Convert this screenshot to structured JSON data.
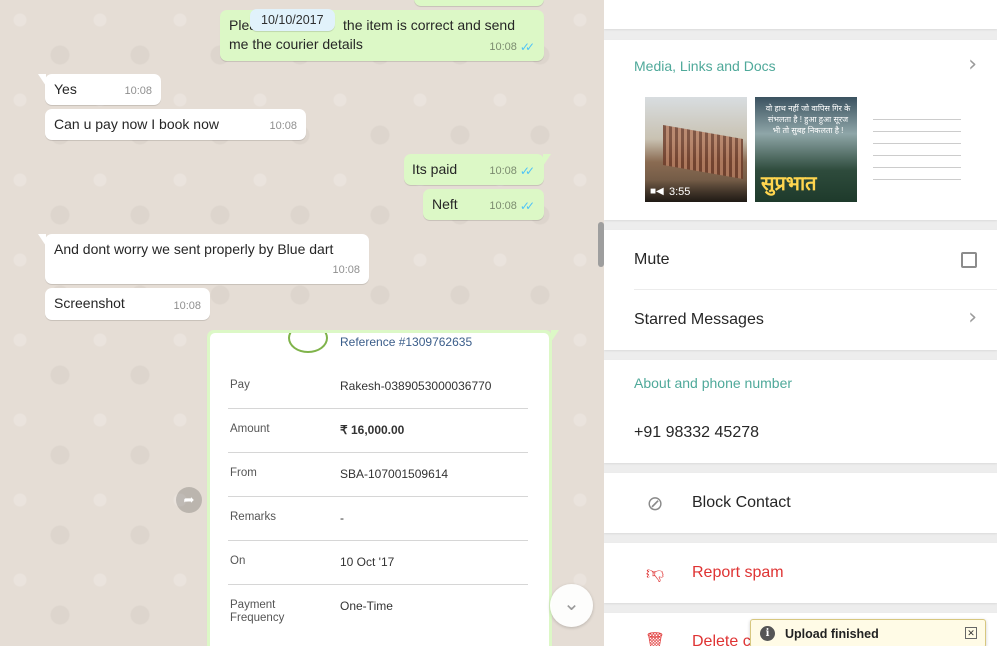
{
  "chat": {
    "date_chip": "10/10/2017",
    "messages": [
      {
        "dir": "out",
        "text": "Please check if the item is correct and send me the courier details",
        "text_line1": "Plea",
        "text_tail": "the item is correct and send",
        "text_line2": "me the courier details",
        "time": "10:08"
      },
      {
        "dir": "in",
        "text": "Yes",
        "time": "10:08"
      },
      {
        "dir": "in",
        "text": "Can u pay now I book now",
        "time": "10:08"
      },
      {
        "dir": "out",
        "text": "Its paid",
        "time": "10:08"
      },
      {
        "dir": "out",
        "text": "Neft",
        "time": "10:08"
      },
      {
        "dir": "in",
        "text": "And dont worry we sent properly by Blue dart",
        "time": "10:08"
      },
      {
        "dir": "in",
        "text": "Screenshot",
        "time": "10:08"
      }
    ],
    "receipt": {
      "reference": "Reference #1309762635",
      "rows": [
        {
          "label": "Pay",
          "value": "Rakesh-0389053000036770"
        },
        {
          "label": "Amount",
          "value": "₹ 16,000.00"
        },
        {
          "label": "From",
          "value": "SBA-107001509614"
        },
        {
          "label": "Remarks",
          "value": "-"
        },
        {
          "label": "On",
          "value": "10 Oct '17"
        },
        {
          "label": "Payment Frequency",
          "value": "One-Time"
        }
      ]
    },
    "icons": {
      "forward": "forward-icon",
      "scroll_down": "chevron-down-icon",
      "read_receipt": "double-check-icon"
    }
  },
  "info": {
    "media_title": "Media, Links and Docs",
    "media": {
      "video_duration": "3:55",
      "thumb2_text": "वो हाथ नहीं जो वापिस गिर के संभलता है ! हुआ हुआ सूरज भी तो सुबह निकलता है !",
      "thumb2_big": "सुप्रभात"
    },
    "mute_label": "Mute",
    "starred_label": "Starred Messages",
    "about_title": "About and phone number",
    "phone": "+91 98332 45278",
    "block_label": "Block Contact",
    "report_label": "Report spam",
    "delete_label": "Delete c",
    "colors": {
      "accent": "#4fa99a",
      "danger": "#df3333",
      "outgoing": "#dcf8c6",
      "chat_bg": "#e5ddd5"
    }
  },
  "toast": {
    "text": "Upload finished"
  }
}
